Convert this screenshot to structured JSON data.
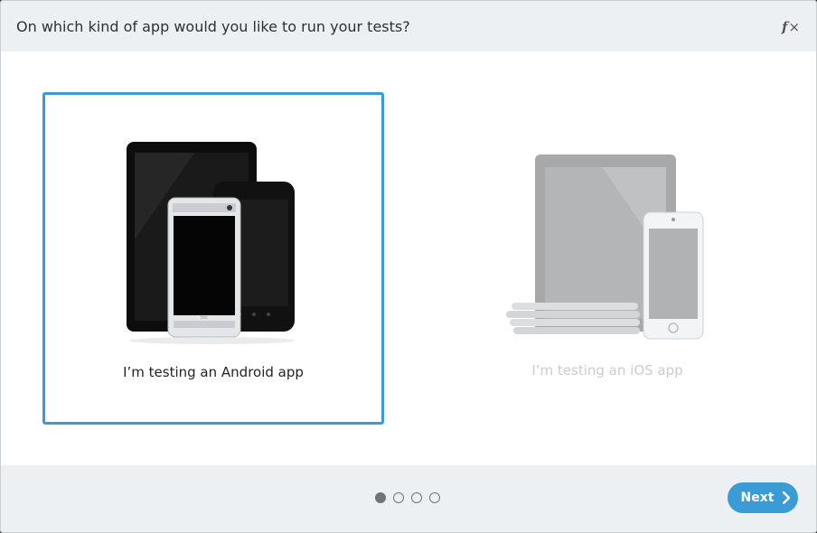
{
  "dialog": {
    "title": "On which kind of app would you like to run your tests?",
    "close_label": "×"
  },
  "options": [
    {
      "label": "I’m testing an Android app",
      "selected": true
    },
    {
      "label": "I’m testing an iOS app",
      "selected": false
    }
  ],
  "pagination": {
    "total": 4,
    "current": 1
  },
  "footer": {
    "next_label": "Next"
  },
  "colors": {
    "accent": "#3a9bd5",
    "header_bg": "#edf0f2",
    "disabled_text": "#c9ccd0"
  }
}
